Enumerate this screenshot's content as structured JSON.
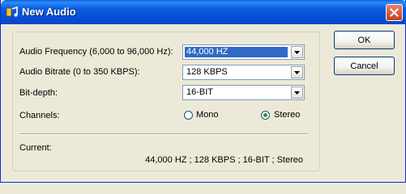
{
  "window": {
    "title": "New Audio"
  },
  "form": {
    "frequency_label": "Audio Frequency (6,000 to 96,000 Hz):",
    "frequency_value": "44,000 HZ",
    "bitrate_label": "Audio Bitrate (0 to 350 KBPS):",
    "bitrate_value": "128 KBPS",
    "bitdepth_label": "Bit-depth:",
    "bitdepth_value": "16-BIT",
    "channels_label": "Channels:",
    "channels_options": [
      "Mono",
      "Stereo"
    ],
    "channels_selected": "Stereo",
    "current_label": "Current:",
    "current_value": "44,000 HZ ; 128 KBPS ; 16-BIT ; Stereo"
  },
  "buttons": {
    "ok_label": "OK",
    "cancel_label": "Cancel"
  },
  "colors": {
    "title_bar": "#0550D6",
    "selection": "#316AC5",
    "dialog_bg": "#ECE9D8",
    "close_button": "#C1401E"
  }
}
